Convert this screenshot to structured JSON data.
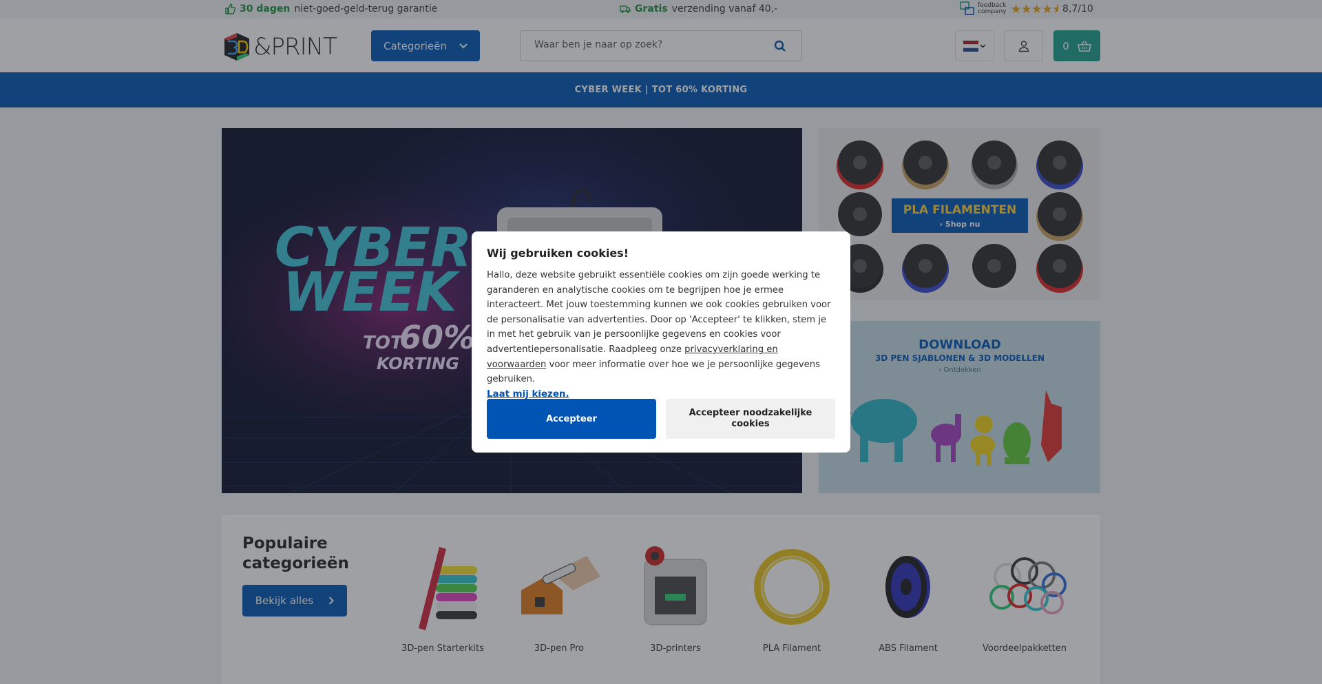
{
  "usp": {
    "guarantee_bold": "30 dagen",
    "guarantee_text": "niet-goed-geld-terug garantie",
    "shipping_bold": "Gratis",
    "shipping_text": "verzending vanaf 40,-",
    "feedback_line1": "feedback",
    "feedback_line2": "company",
    "rating": "8,7/10",
    "rating_stars": 4.5
  },
  "header": {
    "logo_text": "&PRINT",
    "categories_label": "Categorieën",
    "search_placeholder": "Waar ben je naar op zoek?",
    "cart_count": "0"
  },
  "promo": {
    "text": "CYBER WEEK | TOT 60% KORTING"
  },
  "hero": {
    "title_line1": "CYBER",
    "title_line2": "WEEK",
    "tot": "TOT",
    "percent": "60%",
    "korting": "KORTING"
  },
  "side_banners": {
    "filament_title": "PLA FILAMENTEN",
    "filament_cta": "› Shop nu",
    "download_title": "DOWNLOAD",
    "download_subtitle": "3D PEN SJABLONEN & 3D MODELLEN",
    "download_cta": "› Ontdekken"
  },
  "categories": {
    "title": "Populaire categorieën",
    "view_all": "Bekijk alles",
    "items": [
      {
        "label": "3D-pen Starterkits"
      },
      {
        "label": "3D-pen Pro"
      },
      {
        "label": "3D-printers"
      },
      {
        "label": "PLA Filament"
      },
      {
        "label": "ABS Filament"
      },
      {
        "label": "Voordeelpakketten"
      }
    ]
  },
  "cookie": {
    "title": "Wij gebruiken cookies!",
    "body": "Hallo, deze website gebruikt essentiële cookies om zijn goede werking te garanderen en analytische cookies om te begrijpen hoe je ermee interacteert. Met jouw toestemming kunnen we ook cookies gebruiken voor de personalisatie van advertenties. Door op 'Accepteer' te klikken, stem je in met het gebruik van je persoonlijke gegevens en cookies voor advertentiepersonalisatie. Raadpleeg onze ",
    "privacy_link": "privacyverklaring en voorwaarden",
    "body_end": " voor meer informatie over hoe we je persoonlijke gegevens gebruiken.",
    "choose_link": "Laat mij kiezen.",
    "accept": "Accepteer",
    "accept_necessary": "Accepteer noodzakelijke cookies"
  },
  "colors": {
    "primary_blue": "#0054b4",
    "cart_teal": "#1a9e8c",
    "usp_green": "#1c8f3a",
    "star_gold": "#e8a317"
  }
}
